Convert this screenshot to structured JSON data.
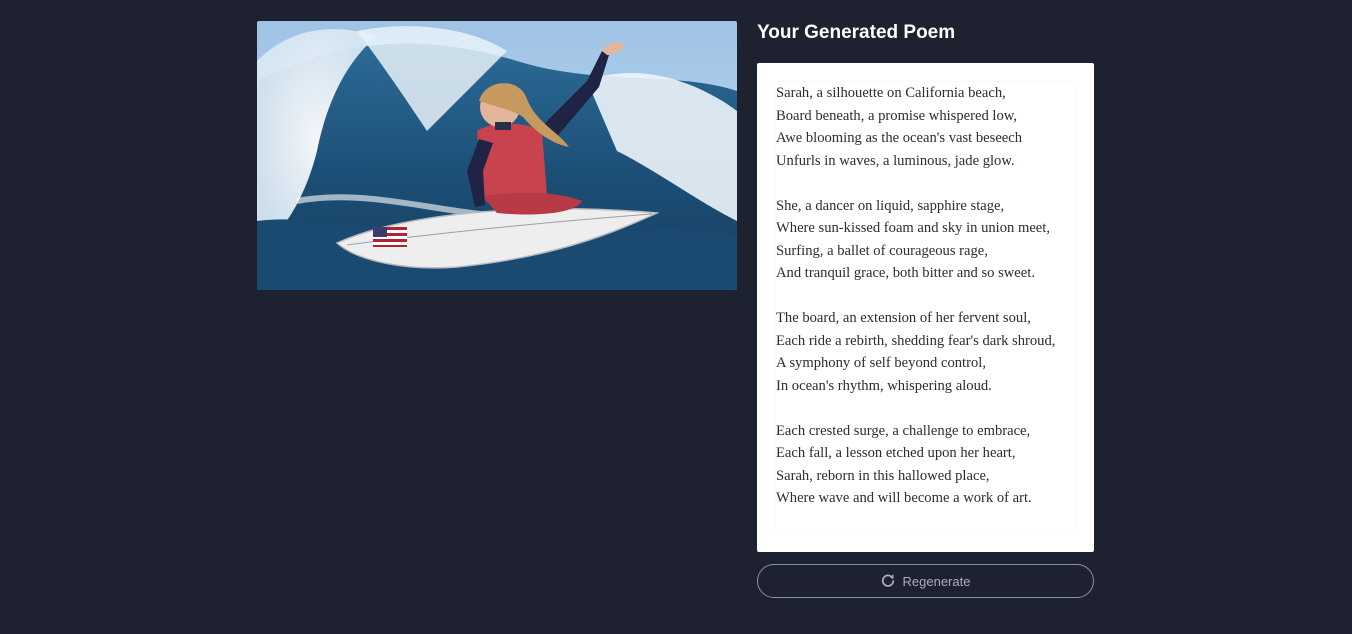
{
  "photo": {
    "alt": "Surfer riding a wave",
    "icon": "surfer-photo"
  },
  "poem": {
    "title": "Your Generated Poem",
    "text": "Sarah, a silhouette on California beach,\nBoard beneath, a promise whispered low,\nAwe blooming as the ocean's vast beseech\nUnfurls in waves, a luminous, jade glow.\n\nShe, a dancer on liquid, sapphire stage,\nWhere sun-kissed foam and sky in union meet,\nSurfing, a ballet of courageous rage,\nAnd tranquil grace, both bitter and so sweet.\n\nThe board, an extension of her fervent soul,\nEach ride a rebirth, shedding fear's dark shroud,\nA symphony of self beyond control,\nIn ocean's rhythm, whispering aloud.\n\nEach crested surge, a challenge to embrace,\nEach fall, a lesson etched upon her heart,\nSarah, reborn in this hallowed place,\nWhere wave and will become a work of art."
  },
  "actions": {
    "regenerate_label": "Regenerate",
    "regenerate_icon": "refresh-icon"
  },
  "colors": {
    "background": "#1d2130",
    "card": "#ffffff",
    "button_border": "#8a90a3"
  }
}
